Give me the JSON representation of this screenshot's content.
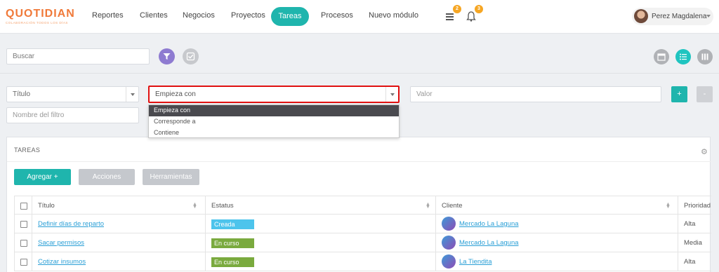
{
  "app": {
    "logo_text": "QUOTIDIAN",
    "logo_tagline": "COLABORACIÓN TODOS LOS DÍAS"
  },
  "nav": {
    "items": [
      "Reportes",
      "Clientes",
      "Negocios",
      "Proyectos",
      "Tareas",
      "Procesos",
      "Nuevo módulo"
    ],
    "active": "Tareas",
    "notifications": [
      {
        "icon": "list-icon",
        "count": "2"
      },
      {
        "icon": "bell-icon",
        "count": "3"
      }
    ],
    "user": "Perez Magdalena"
  },
  "search": {
    "placeholder": "Buscar"
  },
  "filter": {
    "field_value": "Título",
    "operator_value": "Empieza con",
    "value_placeholder": "Valor",
    "name_placeholder": "Nombre del filtro",
    "add_label": "+",
    "remove_label": "-",
    "operator_options": [
      "Empieza con",
      "Corresponde a",
      "Contiene"
    ]
  },
  "panel": {
    "title": "TAREAS",
    "buttons": {
      "add": "Agregar +",
      "actions": "Acciones",
      "tools": "Herramientas"
    }
  },
  "table": {
    "columns": [
      "Título",
      "Estatus",
      "Cliente",
      "Prioridad"
    ],
    "rows": [
      {
        "title": "Definir días de reparto",
        "status": "Creada",
        "client": "Mercado La Laguna",
        "priority": "Alta"
      },
      {
        "title": "Sacar permisos",
        "status": "En curso",
        "client": "Mercado La Laguna",
        "priority": "Media"
      },
      {
        "title": "Cotizar insumos",
        "status": "En curso",
        "client": "La Tiendita",
        "priority": "Alta"
      }
    ]
  },
  "colors": {
    "accent": "#1fb5ad",
    "filter": "#8e7bd1",
    "status_created": "#4dc4ec",
    "status_in_progress": "#7aaa3e",
    "highlight_border": "#e01010",
    "badge": "#f6a623",
    "link": "#2a9fd6"
  }
}
